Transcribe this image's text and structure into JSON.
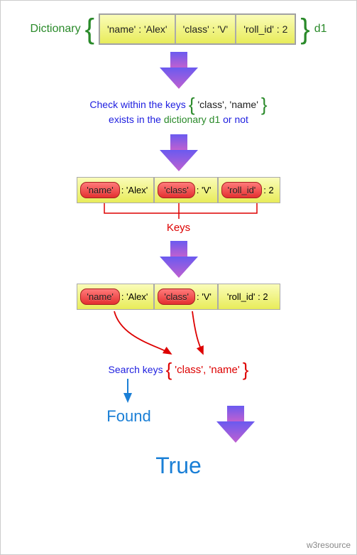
{
  "step1": {
    "label": "Dictionary",
    "cells": [
      "'name' : 'Alex'",
      "'class' : 'V'",
      "'roll_id' : 2"
    ],
    "var": "d1"
  },
  "step2": {
    "line1_pre": "Check within the keys",
    "keys_inline": "'class', 'name'",
    "line2_pre": "exists in the",
    "dict_ref": "dictionary d1",
    "line2_post": "or not"
  },
  "step3": {
    "cells": [
      {
        "pill": "'name'",
        "rest": ": 'Alex'"
      },
      {
        "pill": "'class'",
        "rest": ": 'V'"
      },
      {
        "pill": "'roll_id'",
        "rest": ": 2"
      }
    ],
    "keys_label": "Keys"
  },
  "step4": {
    "cells": [
      {
        "pill": "'name'",
        "rest": ": 'Alex'",
        "highlight": true
      },
      {
        "pill": "'class'",
        "rest": ": 'V'",
        "highlight": true
      },
      {
        "plain": "'roll_id' : 2",
        "highlight": false
      }
    ],
    "search_label": "Search keys",
    "search_keys": "'class', 'name'"
  },
  "found": "Found",
  "result": "True",
  "attribution": "w3resource"
}
